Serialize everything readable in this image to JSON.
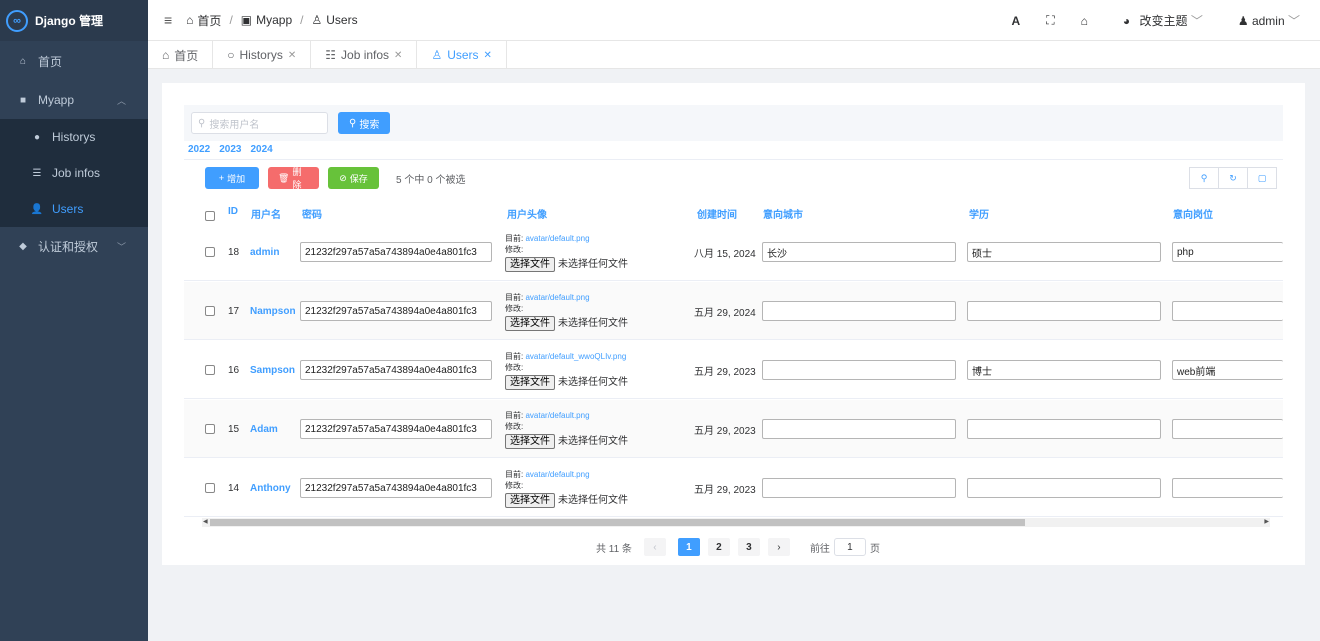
{
  "app": {
    "logo_text": "∞",
    "title": "Django 管理"
  },
  "sidebar": {
    "items": [
      {
        "label": "首页"
      },
      {
        "label": "Myapp"
      },
      {
        "label": "Historys"
      },
      {
        "label": "Job infos"
      },
      {
        "label": "Users"
      },
      {
        "label": "认证和授权"
      }
    ]
  },
  "breadcrumb": {
    "home": "首页",
    "app": "Myapp",
    "model": "Users",
    "sep": "/"
  },
  "topbar": {
    "theme_label": "改变主题",
    "user_label": "admin"
  },
  "tabs": [
    {
      "label": "首页"
    },
    {
      "label": "Historys"
    },
    {
      "label": "Job infos"
    },
    {
      "label": "Users"
    }
  ],
  "search": {
    "placeholder": "搜索用户名",
    "button": "搜索"
  },
  "years": [
    "2022",
    "2023",
    "2024"
  ],
  "actions": {
    "add": "增加",
    "delete": "删除",
    "save": "保存",
    "selection_info": "5 个中 0 个被选"
  },
  "table": {
    "headers": [
      "ID",
      "用户名",
      "密码",
      "用户头像",
      "创建时间",
      "意向城市",
      "学历",
      "意向岗位"
    ],
    "current_label": "目前:",
    "change_label": "修改:",
    "file_button": "选择文件",
    "no_file": "未选择任何文件",
    "rows": [
      {
        "id": "18",
        "username": "admin",
        "password": "21232f297a57a5a743894a0e4a801fc3",
        "avatar": "avatar/default.png",
        "created": "八月 15, 2024",
        "city": "长沙",
        "education": "硕士",
        "job": "php"
      },
      {
        "id": "17",
        "username": "Nampson",
        "password": "21232f297a57a5a743894a0e4a801fc3",
        "avatar": "avatar/default.png",
        "created": "五月 29, 2024",
        "city": "",
        "education": "",
        "job": ""
      },
      {
        "id": "16",
        "username": "Sampson",
        "password": "21232f297a57a5a743894a0e4a801fc3",
        "avatar": "avatar/default_wwoQLIv.png",
        "created": "五月 29, 2023",
        "city": "",
        "education": "博士",
        "job": "web前端"
      },
      {
        "id": "15",
        "username": "Adam",
        "password": "21232f297a57a5a743894a0e4a801fc3",
        "avatar": "avatar/default.png",
        "created": "五月 29, 2023",
        "city": "",
        "education": "",
        "job": ""
      },
      {
        "id": "14",
        "username": "Anthony",
        "password": "21232f297a57a5a743894a0e4a801fc3",
        "avatar": "avatar/default.png",
        "created": "五月 29, 2023",
        "city": "",
        "education": "",
        "job": ""
      }
    ]
  },
  "pagination": {
    "total": "共 11 条",
    "pages": [
      "1",
      "2",
      "3"
    ],
    "current": "1",
    "goto_prefix": "前往",
    "goto_value": "1",
    "goto_suffix": "页"
  },
  "colors": {
    "primary": "#409eff",
    "danger": "#f56c6c",
    "success": "#67c23a",
    "sidebar_bg": "#304156"
  }
}
